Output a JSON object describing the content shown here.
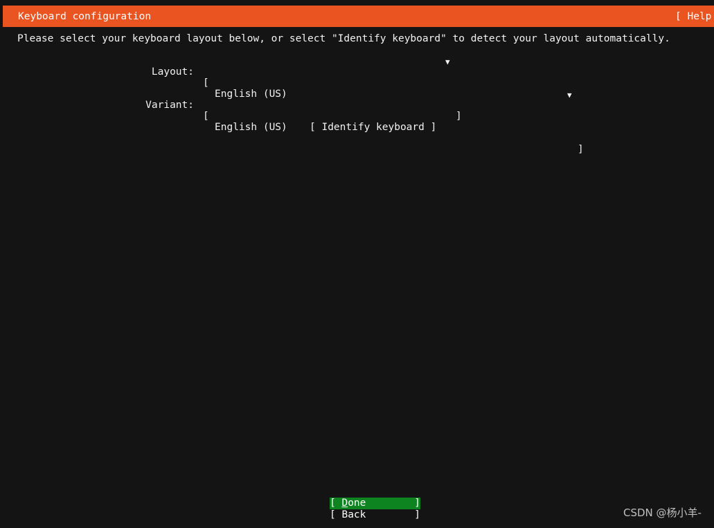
{
  "header": {
    "title": "Keyboard configuration",
    "help_label": "[ Help ]",
    "bar_color": "#e95420"
  },
  "main": {
    "instruction": "Please select your keyboard layout below, or select \"Identify keyboard\" to detect your layout automatically.",
    "fields": [
      {
        "label": "Layout:",
        "open_bracket": "[",
        "value": "English (US)",
        "arrow": "▼",
        "close_bracket": "]"
      },
      {
        "label": "Variant:",
        "open_bracket": "[",
        "value": "English (US)",
        "arrow": "▼",
        "close_bracket": "]"
      }
    ],
    "identify_button": "[ Identify keyboard ]"
  },
  "footer": {
    "buttons": [
      {
        "prefix": "[ ",
        "accel": "D",
        "rest": "one        ",
        "suffix": "]",
        "selected": true,
        "selected_color": "#0e8420"
      },
      {
        "prefix": "[ ",
        "accel": "",
        "rest": "Back        ",
        "suffix": "]",
        "selected": false,
        "selected_color": ""
      }
    ]
  },
  "watermark": "CSDN @杨小羊-"
}
